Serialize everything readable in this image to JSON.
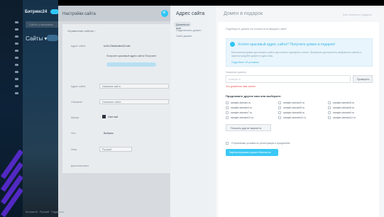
{
  "bitrix": {
    "title": "Битрикс24",
    "tab_label": "Сайты и магазины",
    "sites_label": "Сайты ▾"
  },
  "settings": {
    "title": "Настройки сайта",
    "subtitle": "Управление сайтом ↓",
    "rows": [
      {
        "label": "Адрес сайта",
        "value": "bx24-20sdfsclient24.site"
      },
      {
        "label": "Адрес сайта",
        "value": "Название сайта"
      },
      {
        "label": "Описание",
        "value": "Описание сайта"
      },
      {
        "label": "Шрифт",
        "value": "Светлый"
      },
      {
        "label": "Фон",
        "value": "Выбрать"
      },
      {
        "label": "Язык",
        "value": "Русский"
      }
    ],
    "hint": "Получите красивый адрес сайта! Получите",
    "more": "Дополнительно"
  },
  "menu": {
    "title": "Адрес сайта",
    "items": [
      "Доменное имя",
      "Подключить домен",
      "Свой домен"
    ]
  },
  "domain": {
    "title": "Домен в подарок",
    "hint": "Как получить подарок",
    "pick_label": "Подберите домен из списка или введите свой",
    "promo_title": "Хотите красивый адрес сайта? Получите домен в подарок!",
    "promo_text": "Бесплатный домен для вашего сайта при оплате тарифного плана. Проверьте доступность выбранного имени и зарегистрируйте домен в один клик.",
    "promo_link": "Подробнее об условиях",
    "name_label": "Название домена",
    "name_placeholder": "example.ru",
    "check_label": "Проверить",
    "error_text": "Это доменное имя занято",
    "suggest_title": "Предложите другое имя или выберите:",
    "suggestions": [
      "sample-domain.ru",
      "sample-domain2.ru",
      "sample-domain3.ru",
      "sample-domain4.ru",
      "sample-domain5.ru",
      "sample-domain6.ru",
      "sample-domain7.ru",
      "sample-domain8.ru",
      "sample-domain9.ru",
      "sample-domain10.ru",
      "sample-domain11.ru",
      "sample-domain12.ru"
    ],
    "more_label": "Показать другие варианты",
    "agree_text": "Я принимаю условия по регистрации и продлению",
    "register_label": "Зарегистрировать домен бесплатно"
  },
  "footer": {
    "text": "Битрикс24 · Русский · Поддержка"
  },
  "colors": {
    "accent": "#2fc6f6",
    "error": "#e85550",
    "panel": "#f4f6f8"
  }
}
